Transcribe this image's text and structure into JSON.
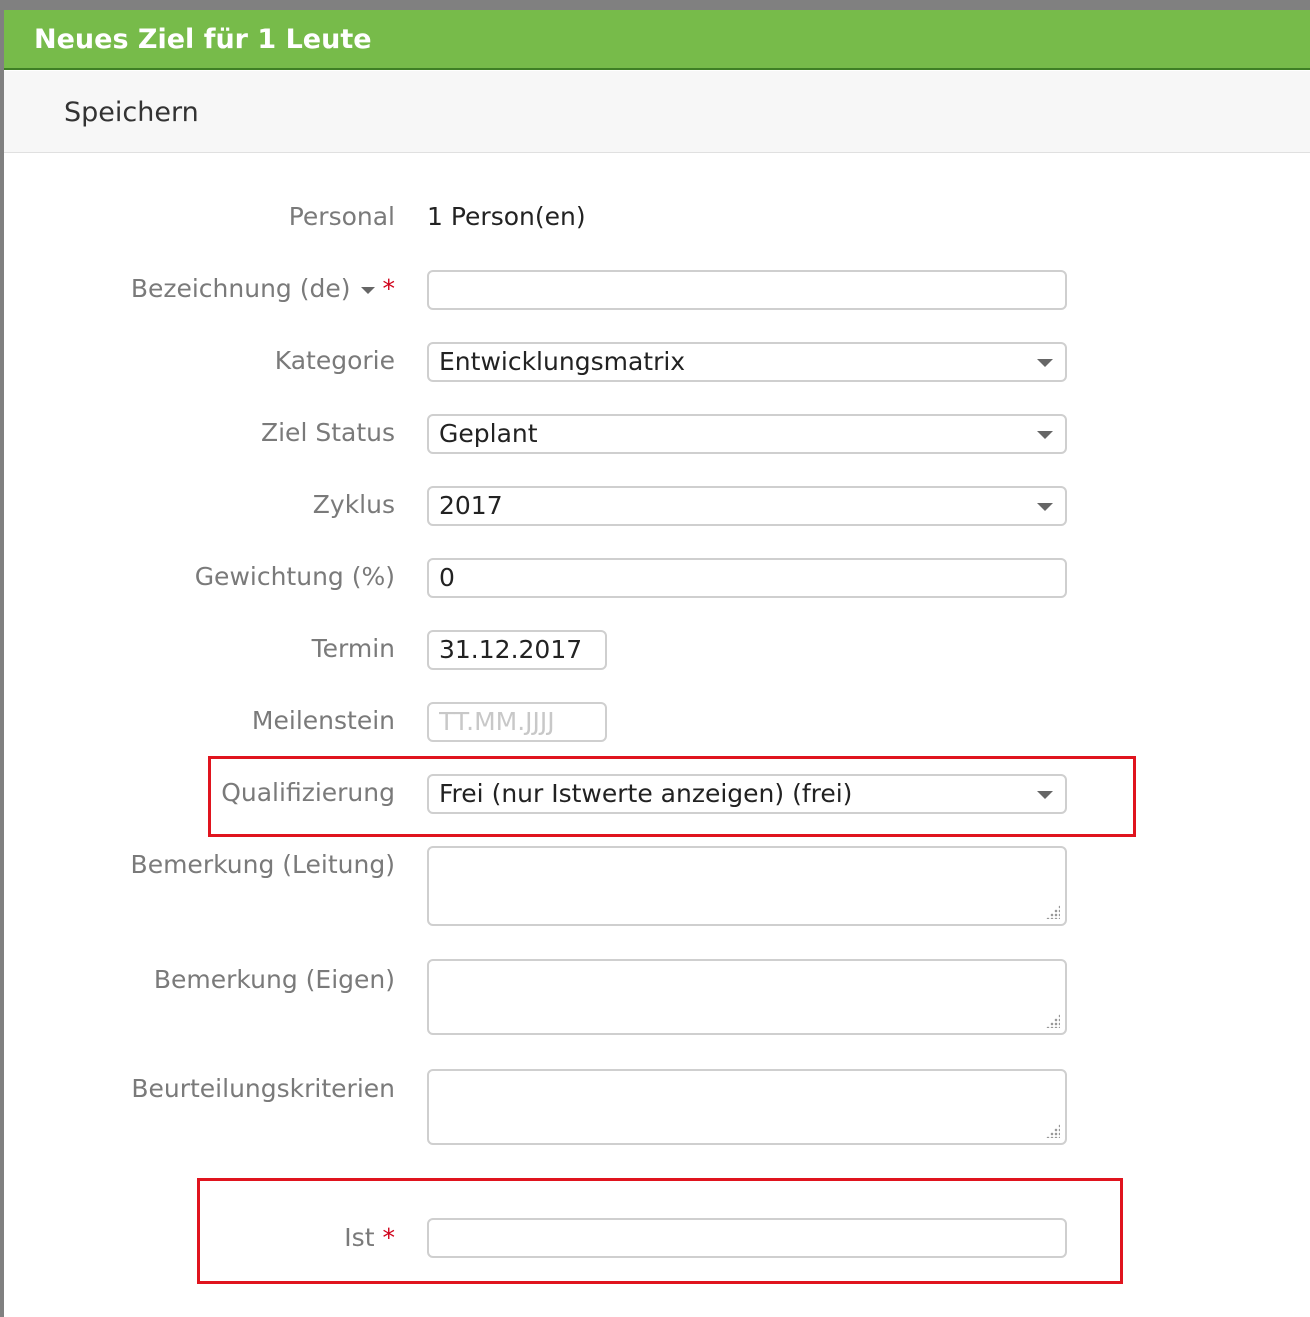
{
  "dialog": {
    "title": "Neues Ziel für 1 Leute",
    "toolbar": {
      "save_label": "Speichern"
    }
  },
  "form": {
    "personal": {
      "label": "Personal",
      "value": "1 Person(en)"
    },
    "bezeichnung": {
      "label": "Bezeichnung (de)",
      "required_mark": "*",
      "value": ""
    },
    "kategorie": {
      "label": "Kategorie",
      "value": "Entwicklungsmatrix"
    },
    "ziel_status": {
      "label": "Ziel Status",
      "value": "Geplant"
    },
    "zyklus": {
      "label": "Zyklus",
      "value": "2017"
    },
    "gewichtung": {
      "label": "Gewichtung (%)",
      "value": "0"
    },
    "termin": {
      "label": "Termin",
      "value": "31.12.2017"
    },
    "meilenstein": {
      "label": "Meilenstein",
      "value": "",
      "placeholder": "TT.MM.JJJJ"
    },
    "qualifizierung": {
      "label": "Qualifizierung",
      "value": "Frei (nur Istwerte anzeigen) (frei)"
    },
    "bemerkung_leitung": {
      "label": "Bemerkung (Leitung)",
      "value": ""
    },
    "bemerkung_eigen": {
      "label": "Bemerkung (Eigen)",
      "value": ""
    },
    "beurteilungskriterien": {
      "label": "Beurteilungskriterien",
      "value": ""
    },
    "ist": {
      "label": "Ist",
      "required_mark": "*",
      "value": ""
    }
  },
  "highlight_color": "#e0141e",
  "title_bar_color": "#77bb4a"
}
